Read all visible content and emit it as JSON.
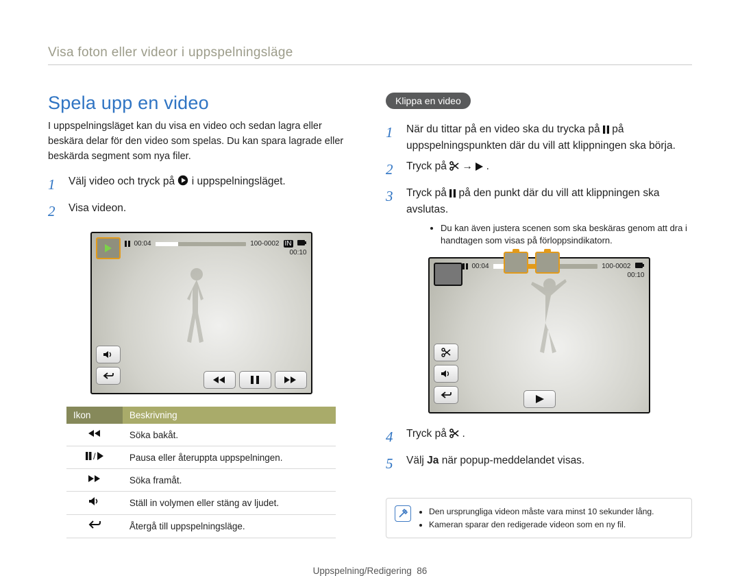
{
  "header": {
    "title": "Visa foton eller videor i uppspelningsläge"
  },
  "left": {
    "section_title": "Spela upp en video",
    "intro": "I uppspelningsläget kan du visa en video och sedan lagra eller beskära delar för den video som spelas. Du kan spara lagrade eller beskärda segment som nya filer.",
    "step1_pre": "Välj video och tryck på ",
    "step1_post": " i uppspelningsläget.",
    "step2": "Visa videon.",
    "preview": {
      "elapsed": "00:04",
      "total": "00:10",
      "label": "100-0002",
      "in_badge": "IN"
    },
    "table": {
      "h1": "Ikon",
      "h2": "Beskrivning",
      "rows": [
        {
          "icon": "rewind-icon",
          "desc": "Söka bakåt."
        },
        {
          "icon": "pause-play-icon",
          "desc": "Pausa eller återuppta uppspelningen."
        },
        {
          "icon": "fastforward-icon",
          "desc": "Söka framåt."
        },
        {
          "icon": "volume-icon",
          "desc": "Ställ in volymen eller stäng av ljudet."
        },
        {
          "icon": "back-icon",
          "desc": "Återgå till uppspelningsläge."
        }
      ]
    }
  },
  "right": {
    "pill": "Klippa en video",
    "step1_pre": "När du tittar på en video ska du trycka på ",
    "step1_post": " på uppspelningspunkten där du vill att klippningen ska börja.",
    "step2_pre": "Tryck på ",
    "step2_mid": " → ",
    "step2_post": ".",
    "step3_pre": "Tryck på ",
    "step3_post": " på den punkt där du vill att klippningen ska avslutas.",
    "bullets": [
      "Du kan även justera scenen som ska beskäras genom att dra i handtagen som visas på förloppsindikatorn."
    ],
    "preview": {
      "elapsed": "00:04",
      "total": "00:10",
      "label": "100-0002"
    },
    "step4_pre": "Tryck på ",
    "step4_post": ".",
    "step5_pre": "Välj ",
    "step5_bold": "Ja",
    "step5_post": " när popup-meddelandet visas.",
    "notes": [
      "Den ursprungliga videon måste vara minst 10 sekunder lång.",
      "Kameran sparar den redigerade videon som en ny fil."
    ]
  },
  "footer": {
    "section": "Uppspelning/Redigering",
    "page": "86"
  }
}
